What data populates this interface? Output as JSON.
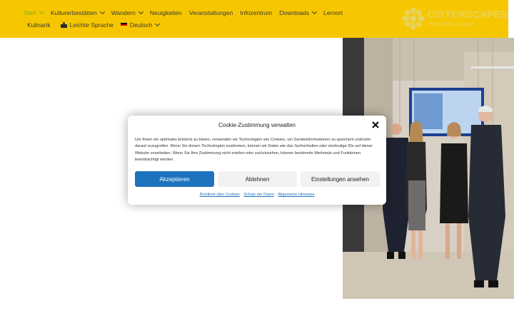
{
  "header": {
    "bg_color": "#f6c700",
    "active_color": "#7ab317",
    "nav_row1": [
      {
        "label": "Start",
        "dropdown": true,
        "active": true
      },
      {
        "label": "Kulturerbestätten",
        "dropdown": true
      },
      {
        "label": "Wandern",
        "dropdown": true
      },
      {
        "label": "Neuigkeiten",
        "dropdown": false
      },
      {
        "label": "Veranstaltungen",
        "dropdown": false
      },
      {
        "label": "Infozentrum",
        "dropdown": false
      },
      {
        "label": "Downloads",
        "dropdown": true
      },
      {
        "label": "Lernort",
        "dropdown": false
      }
    ],
    "nav_row2": {
      "kulinarik": "Kulinarik",
      "easy_language": "Leichte Sprache",
      "language": "Deutsch"
    },
    "logo": {
      "name": "CISTERSCAPES",
      "tagline": "connecting Europe"
    }
  },
  "cookie_dialog": {
    "title": "Cookie-Zustimmung verwalten",
    "text": "Um Ihnen ein optimales Erlebnis zu bieten, verwenden wir Technologien wie Cookies, um Geräteinformationen zu speichern und/oder darauf zuzugreifen. Wenn Sie diesen Technologien zustimmen, können wir Daten wie das Surfverhalten oder eindeutige IDs auf dieser Website verarbeiten. Wenn Sie Ihre Zustimmung nicht erteilen oder zurückziehen, können bestimmte Merkmale und Funktionen beeinträchtigt werden.",
    "accept_label": "Akzeptieren",
    "deny_label": "Ablehnen",
    "settings_label": "Einstellungen ansehen",
    "links": [
      "Richtlinie über Cookies",
      "Schutz der Daten",
      "Allgemeine Hinweise"
    ],
    "accent_color": "#1e73be"
  }
}
